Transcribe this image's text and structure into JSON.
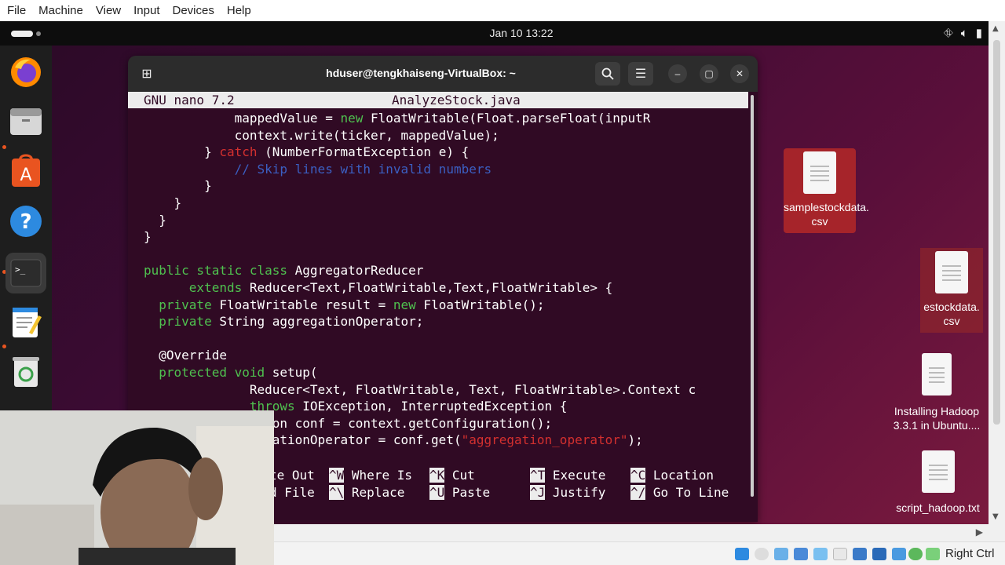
{
  "vbox_menu": [
    "File",
    "Machine",
    "View",
    "Input",
    "Devices",
    "Help"
  ],
  "topbar": {
    "clock": "Jan 10  13:22"
  },
  "dock": [
    "Firefox",
    "Files",
    "App Center",
    "Help",
    "Terminal",
    "Text Editor",
    "Trash"
  ],
  "desktop_icons": [
    {
      "label": "samplestockdata.\ncsv"
    },
    {
      "label": "estockdata.\ncsv"
    },
    {
      "label": "Installing Hadoop\n3.3.1 in Ubuntu...."
    },
    {
      "label": "script_hadoop.txt"
    }
  ],
  "terminal": {
    "title": "hduser@tengkhaiseng-VirtualBox: ~",
    "nano_version": "GNU nano 7.2",
    "filename": "AnalyzeStock.java"
  },
  "code": [
    {
      "t": [
        {
          "c": "            mappedValue = "
        },
        {
          "c": "new",
          "s": "kw"
        },
        {
          "c": " FloatWritable(Float.parseFloat(inputR"
        }
      ]
    },
    {
      "t": [
        {
          "c": "            context.write(ticker, mappedValue);"
        }
      ]
    },
    {
      "t": [
        {
          "c": "        } "
        },
        {
          "c": "catch",
          "s": "red"
        },
        {
          "c": " (NumberFormatException e) {"
        }
      ]
    },
    {
      "t": [
        {
          "c": "            // Skip lines with invalid numbers",
          "s": "cm"
        }
      ]
    },
    {
      "t": [
        {
          "c": "        }"
        }
      ]
    },
    {
      "t": [
        {
          "c": "    }"
        }
      ]
    },
    {
      "t": [
        {
          "c": "  }"
        }
      ]
    },
    {
      "t": [
        {
          "c": "}"
        }
      ]
    },
    {
      "t": [
        {
          "c": ""
        }
      ]
    },
    {
      "t": [
        {
          "c": "public static class",
          "s": "kw"
        },
        {
          "c": " AggregatorReducer"
        }
      ]
    },
    {
      "t": [
        {
          "c": "      "
        },
        {
          "c": "extends",
          "s": "kw"
        },
        {
          "c": " Reducer<Text,FloatWritable,Text,FloatWritable> {"
        }
      ]
    },
    {
      "t": [
        {
          "c": "  "
        },
        {
          "c": "private",
          "s": "kw"
        },
        {
          "c": " FloatWritable result = "
        },
        {
          "c": "new",
          "s": "kw"
        },
        {
          "c": " FloatWritable();"
        }
      ]
    },
    {
      "t": [
        {
          "c": "  "
        },
        {
          "c": "private",
          "s": "kw"
        },
        {
          "c": " String aggregationOperator;"
        }
      ]
    },
    {
      "t": [
        {
          "c": ""
        }
      ]
    },
    {
      "t": [
        {
          "c": "  @Override"
        }
      ]
    },
    {
      "t": [
        {
          "c": "  "
        },
        {
          "c": "protected void",
          "s": "kw"
        },
        {
          "c": " setup("
        }
      ]
    },
    {
      "t": [
        {
          "c": "              Reducer<Text, FloatWritable, Text, FloatWritable>.Context c"
        }
      ]
    },
    {
      "t": [
        {
          "c": "              "
        },
        {
          "c": "throws",
          "s": "kw"
        },
        {
          "c": " IOException, InterruptedException {"
        }
      ]
    },
    {
      "t": [
        {
          "c": "                 on conf = context.getConfiguration();"
        }
      ]
    },
    {
      "t": [
        {
          "c": "                 ationOperator = conf.get("
        },
        {
          "c": "\"aggregation_operator\"",
          "s": "str"
        },
        {
          "c": ");"
        }
      ]
    }
  ],
  "shortcuts_row1": [
    {
      "key": "",
      "label": "te Out"
    },
    {
      "key": "^W",
      "label": "Where Is"
    },
    {
      "key": "^K",
      "label": "Cut"
    },
    {
      "key": "^T",
      "label": "Execute"
    },
    {
      "key": "^C",
      "label": "Location"
    }
  ],
  "shortcuts_row2": [
    {
      "key": "",
      "label": "d File"
    },
    {
      "key": "^\\",
      "label": "Replace"
    },
    {
      "key": "^U",
      "label": "Paste"
    },
    {
      "key": "^J",
      "label": "Justify"
    },
    {
      "key": "^/",
      "label": "Go To Line"
    }
  ],
  "statusbar": {
    "host_key": "Right Ctrl"
  },
  "colors": {
    "terminal_bg": "#300a24",
    "keyword": "#4fc14f",
    "string": "#d3302f",
    "comment": "#3b5fc2",
    "accent": "#e95420"
  }
}
